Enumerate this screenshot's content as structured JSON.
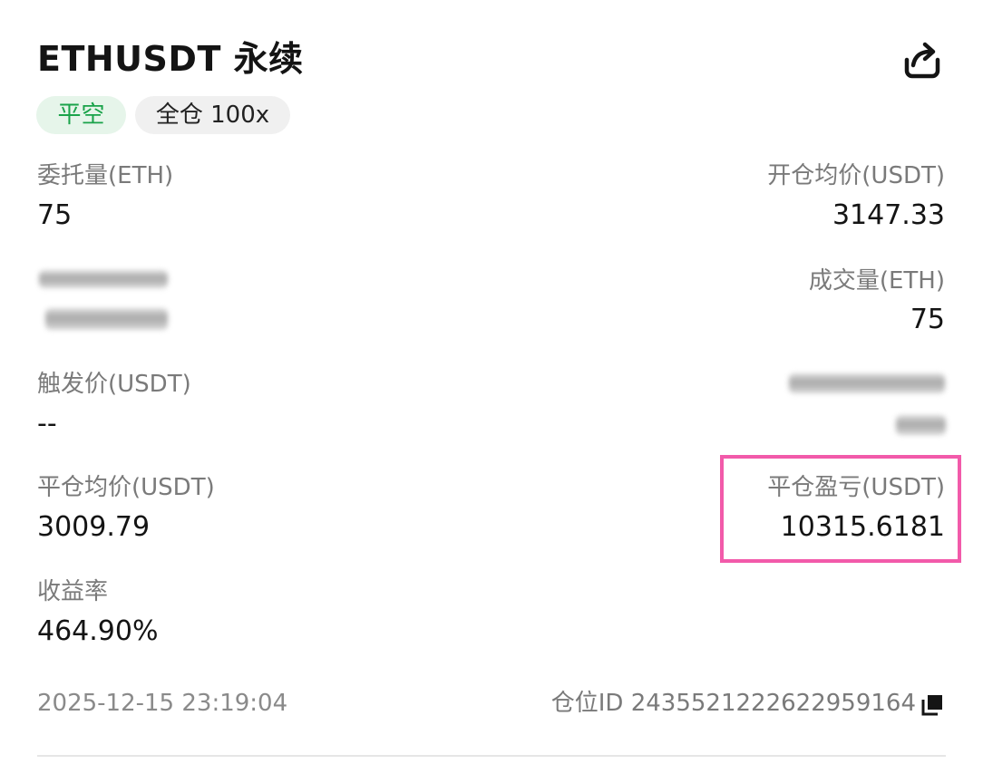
{
  "header": {
    "title": "ETHUSDT 永续",
    "share_icon": "share-icon"
  },
  "tags": {
    "side": "平空",
    "margin": "全仓 100x"
  },
  "fields": {
    "order_qty_label": "委托量(ETH)",
    "order_qty_value": "75",
    "open_avg_label": "开仓均价(USDT)",
    "open_avg_value": "3147.33",
    "filled_qty_label": "成交量(ETH)",
    "filled_qty_value": "75",
    "trigger_label": "触发价(USDT)",
    "trigger_value": "--",
    "close_avg_label": "平仓均价(USDT)",
    "close_avg_value": "3009.79",
    "close_pnl_label": "平仓盈亏(USDT)",
    "close_pnl_value": "10315.6181",
    "roi_label": "收益率",
    "roi_value": "464.90%"
  },
  "footer": {
    "timestamp": "2025-12-15 23:19:04",
    "position_id": "仓位ID 2435521222622959164",
    "copy_icon": "copy-icon"
  },
  "colors": {
    "tag_side_bg": "#e6f5ea",
    "tag_side_text": "#1aa34a",
    "highlight_border": "#f25aaa",
    "label_gray": "#7a7a7a"
  }
}
